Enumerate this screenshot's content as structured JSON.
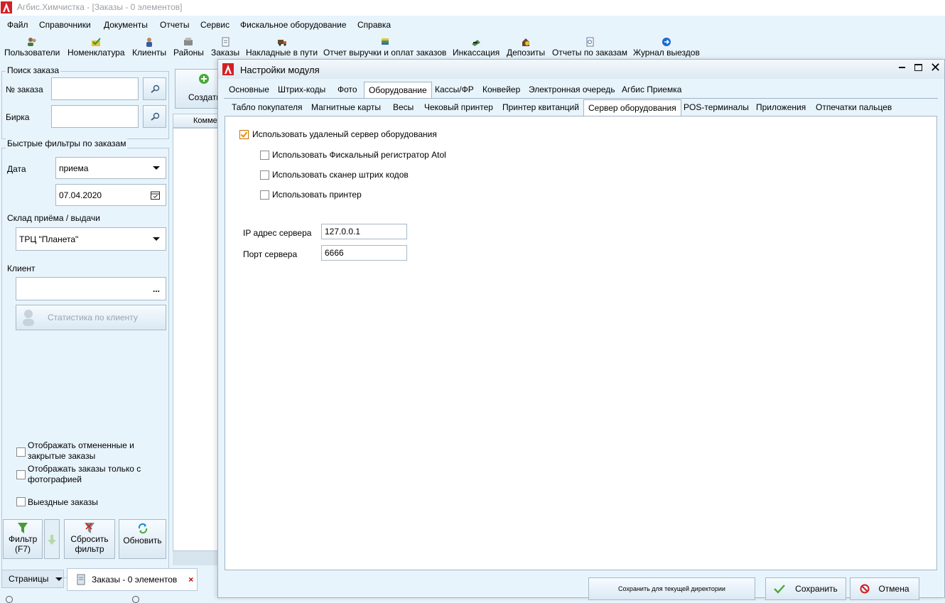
{
  "window": {
    "title": "Агбис.Химчистка - [Заказы - 0 элементов]"
  },
  "menu": [
    "Файл",
    "Справочники",
    "Документы",
    "Отчеты",
    "Сервис",
    "Фискальное оборудование",
    "Справка"
  ],
  "toolbar": [
    {
      "label": "Пользователи",
      "icon": "users-icon"
    },
    {
      "label": "Номенклатура",
      "icon": "nomenclature-icon"
    },
    {
      "label": "Клиенты",
      "icon": "client-icon"
    },
    {
      "label": "Районы",
      "icon": "districts-icon"
    },
    {
      "label": "Заказы",
      "icon": "orders-icon"
    },
    {
      "label": "Накладные в пути",
      "icon": "truck-icon"
    },
    {
      "label": "Отчет выручки и оплат заказов",
      "icon": "money-report-icon"
    },
    {
      "label": "Инкассация",
      "icon": "collection-icon"
    },
    {
      "label": "Депозиты",
      "icon": "deposit-icon"
    },
    {
      "label": "Отчеты по заказам",
      "icon": "report-icon"
    },
    {
      "label": "Журнал выездов",
      "icon": "arrow-right-circle-icon"
    }
  ],
  "left": {
    "search_group": "Поиск заказа",
    "order_no_label": "№ заказа",
    "order_no_value": "",
    "tag_label": "Бирка",
    "tag_value": "",
    "filters_group": "Быстрые фильтры по заказам",
    "date_label": "Дата",
    "date_mode": "приема",
    "date_value": "07.04.2020",
    "warehouse_label": "Склад приёма / выдачи",
    "warehouse_value": "ТРЦ \"Планета\"",
    "client_label": "Клиент",
    "client_value": "",
    "client_more": "...",
    "client_stats": "Статистика по клиенту",
    "chk_cancelled": "Отображать отмененные и закрытые заказы",
    "chk_photo": "Отображать заказы только с фотографией",
    "chk_field": "Выездные заказы",
    "btn_filter": "Фильтр (F7)",
    "btn_reset": "Сбросить фильтр",
    "btn_refresh": "Обновить"
  },
  "middle": {
    "create": "Создать",
    "column": "Комме"
  },
  "bottom": {
    "pages": "Страницы",
    "tab": "Заказы - 0 элементов"
  },
  "modal": {
    "title": "Настройки модуля",
    "tabs1": [
      "Основные",
      "Штрих-коды",
      "Фото",
      "Оборудование",
      "Кассы/ФР",
      "Конвейер",
      "Электронная очередь",
      "Агбис Приемка"
    ],
    "tabs1_active": 3,
    "tabs2": [
      "Табло покупателя",
      "Магнитные карты",
      "Весы",
      "Чековый принтер",
      "Принтер квитанций",
      "Сервер оборудования",
      "POS-терминалы",
      "Приложения",
      "Отпечатки пальцев"
    ],
    "tabs2_active": 5,
    "use_remote": "Использовать удаленый сервер оборудования",
    "use_remote_checked": true,
    "use_atol": "Использовать Фискальный регистратор Atol",
    "use_scanner": "Использовать сканер штрих кодов",
    "use_printer": "Использовать принтер",
    "ip_label": "IP адрес сервера",
    "ip_value": "127.0.0.1",
    "port_label": "Порт сервера",
    "port_value": "6666",
    "btn_save_dir": "Сохранить для текущей директории",
    "btn_save": "Сохранить",
    "btn_cancel": "Отмена"
  },
  "colors": {
    "accent": "#e8f4fc",
    "check": "#f08a00",
    "logo": "#d32027"
  }
}
